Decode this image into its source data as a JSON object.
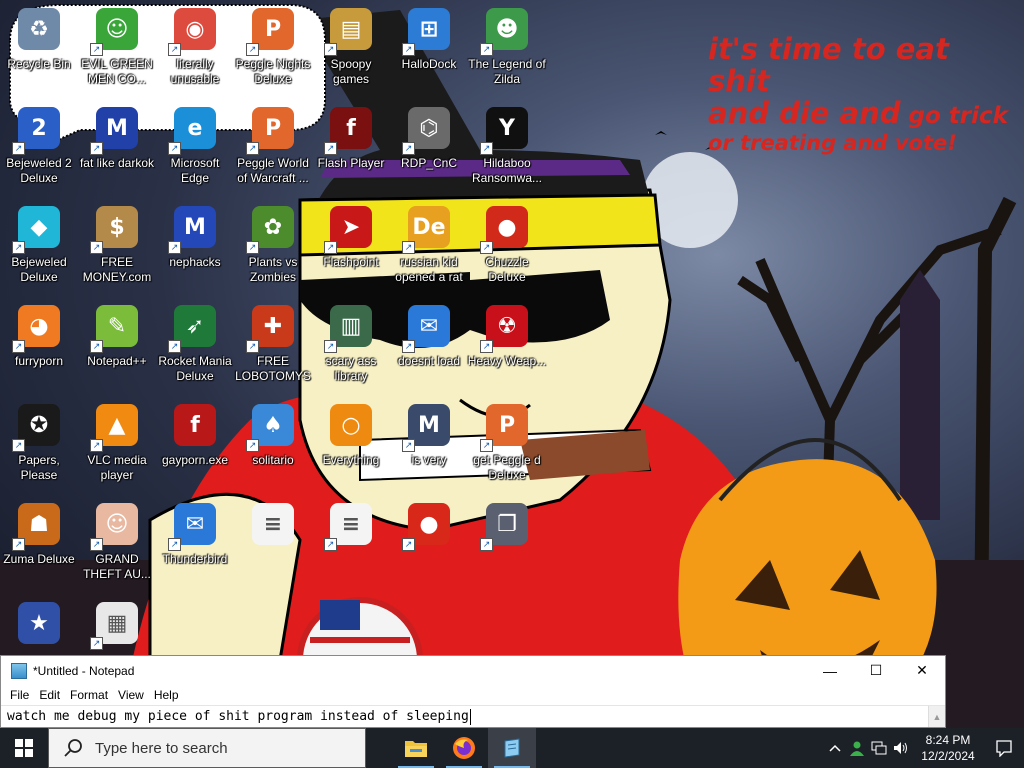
{
  "speech_bubble": {
    "line1": "it's time to eat shit",
    "line2a": "and die and",
    "line2b": " go trick",
    "line3": "or treating and vote!"
  },
  "desktop_icons": [
    {
      "label": "Recycle Bin",
      "icon": "recycle-bin-icon",
      "color": "#6f8aa8",
      "glyph": "♻",
      "shortcut": false
    },
    {
      "label": "EVIL GREEN MEN CO...",
      "icon": "messenger-icon",
      "color": "#3aa63a",
      "glyph": "☺",
      "shortcut": true
    },
    {
      "label": "literally unusable",
      "icon": "chrome-icon",
      "color": "#dd4b3e",
      "glyph": "◉",
      "shortcut": true
    },
    {
      "label": "Peggle Nights Deluxe",
      "icon": "peggle-icon",
      "color": "#e2672d",
      "glyph": "P",
      "shortcut": true
    },
    {
      "label": "Spoopy games",
      "icon": "folder-icon",
      "color": "#c79b3b",
      "glyph": "▤",
      "shortcut": true
    },
    {
      "label": "HalloDock",
      "icon": "windows-shield-icon",
      "color": "#2c7bd4",
      "glyph": "⊞",
      "shortcut": true
    },
    {
      "label": "The Legend of Zilda",
      "icon": "zelda-icon",
      "color": "#3c9a4a",
      "glyph": "☻",
      "shortcut": true
    },
    {
      "label": "Bejeweled 2 Deluxe",
      "icon": "bejeweled-2-icon",
      "color": "#2a5fc8",
      "glyph": "2",
      "shortcut": true
    },
    {
      "label": "fat like darkok",
      "icon": "mpl-icon",
      "color": "#2140a8",
      "glyph": "M",
      "shortcut": true
    },
    {
      "label": "Microsoft Edge",
      "icon": "edge-icon",
      "color": "#1b8fd8",
      "glyph": "e",
      "shortcut": true
    },
    {
      "label": "Peggle World of Warcraft ...",
      "icon": "peggle-wow-icon",
      "color": "#e2672d",
      "glyph": "P",
      "shortcut": true
    },
    {
      "label": "Flash Player",
      "icon": "flash-icon",
      "color": "#7a1010",
      "glyph": "f",
      "shortcut": true
    },
    {
      "label": "RDP_CnC",
      "icon": "rdp-icon",
      "color": "#6a6a6a",
      "glyph": "⌬",
      "shortcut": true
    },
    {
      "label": "Hildaboo Ransomwa...",
      "icon": "yashma-icon",
      "color": "#101010",
      "glyph": "Y",
      "shortcut": true
    },
    {
      "label": "Bejeweled Deluxe",
      "icon": "gem-icon",
      "color": "#1fb6d8",
      "glyph": "◆",
      "shortcut": true
    },
    {
      "label": "FREE MONEY.com",
      "icon": "money-bag-icon",
      "color": "#b38a4a",
      "glyph": "$",
      "shortcut": true
    },
    {
      "label": "nephacks",
      "icon": "mpi-icon",
      "color": "#2448b8",
      "glyph": "M",
      "shortcut": true
    },
    {
      "label": "Plants vs Zombies",
      "icon": "pvz-icon",
      "color": "#4c8c2c",
      "glyph": "✿",
      "shortcut": true
    },
    {
      "label": "Flashpoint",
      "icon": "flashpoint-icon",
      "color": "#c81818",
      "glyph": "➤",
      "shortcut": true
    },
    {
      "label": "russian kid opened a rat",
      "icon": "de-icon",
      "color": "#e8a020",
      "glyph": "De",
      "shortcut": true
    },
    {
      "label": "Chuzzle Deluxe",
      "icon": "chuzzle-icon",
      "color": "#d22a1a",
      "glyph": "●",
      "shortcut": true
    },
    {
      "label": "furryporn",
      "icon": "firefox-icon",
      "color": "#ef7a22",
      "glyph": "◕",
      "shortcut": true
    },
    {
      "label": "Notepad++",
      "icon": "notepad-plus-icon",
      "color": "#7bbd3a",
      "glyph": "✎",
      "shortcut": true
    },
    {
      "label": "Rocket Mania Deluxe",
      "icon": "rocket-mania-icon",
      "color": "#1f7a3a",
      "glyph": "➶",
      "shortcut": true
    },
    {
      "label": "FREE LOBOTOMYS",
      "icon": "lobotomy-icon",
      "color": "#c83a1a",
      "glyph": "✚",
      "shortcut": true
    },
    {
      "label": "scary ass library",
      "icon": "library-icon",
      "color": "#3a6a4a",
      "glyph": "▥",
      "shortcut": true
    },
    {
      "label": "doesnt load",
      "icon": "thunderbird-icon",
      "color": "#2a78d8",
      "glyph": "✉",
      "shortcut": true
    },
    {
      "label": "Heavy Weap...",
      "icon": "radiation-icon",
      "color": "#c8101a",
      "glyph": "☢",
      "shortcut": true
    },
    {
      "label": "Papers, Please",
      "icon": "papers-please-icon",
      "color": "#1a1a1a",
      "glyph": "✪",
      "shortcut": true
    },
    {
      "label": "VLC media player",
      "icon": "vlc-icon",
      "color": "#f08a10",
      "glyph": "▲",
      "shortcut": true
    },
    {
      "label": "gayporn.exe",
      "icon": "flash-exe-icon",
      "color": "#b81818",
      "glyph": "f",
      "shortcut": false
    },
    {
      "label": "solitario",
      "icon": "solitaire-icon",
      "color": "#3a88d8",
      "glyph": "♠",
      "shortcut": true
    },
    {
      "label": "Everything",
      "icon": "everything-search-icon",
      "color": "#ef8a10",
      "glyph": "○",
      "shortcut": false
    },
    {
      "label": "is very",
      "icon": "mpi-shield-icon",
      "color": "#3a4a6a",
      "glyph": "M",
      "shortcut": true
    },
    {
      "label": "get Peggle d Deluxe",
      "icon": "peggle-deluxe-icon",
      "color": "#e2672d",
      "glyph": "P",
      "shortcut": true
    },
    {
      "label": "Zuma Deluxe",
      "icon": "zuma-icon",
      "color": "#c86a1a",
      "glyph": "☗",
      "shortcut": true
    },
    {
      "label": "GRAND THEFT AU...",
      "icon": "anime-girl-icon",
      "color": "#e8b8a0",
      "glyph": "☺",
      "shortcut": true
    },
    {
      "label": "Thunderbird",
      "icon": "thunderbird-2-icon",
      "color": "#2a78d8",
      "glyph": "✉",
      "shortcut": true
    },
    {
      "label": "",
      "icon": "text-document-icon",
      "color": "#f4f4f4",
      "glyph": "≡",
      "shortcut": false
    },
    {
      "label": "",
      "icon": "text-document-2-icon",
      "color": "#f4f4f4",
      "glyph": "≡",
      "shortcut": true
    },
    {
      "label": "",
      "icon": "angry-birds-icon",
      "color": "#d8281a",
      "glyph": "●",
      "shortcut": true
    },
    {
      "label": "",
      "icon": "windows-stack-icon",
      "color": "#5a6070",
      "glyph": "❐",
      "shortcut": true
    },
    {
      "label": "",
      "icon": "vote-badge-icon",
      "color": "#3050a8",
      "glyph": "★",
      "shortcut": false
    },
    {
      "label": "",
      "icon": "pixel-cat-icon",
      "color": "#e8e8e8",
      "glyph": "▦",
      "shortcut": true
    }
  ],
  "notepad": {
    "title": "*Untitled - Notepad",
    "menu": [
      "File",
      "Edit",
      "Format",
      "View",
      "Help"
    ],
    "content": "watch me debug my piece of shit program instead of sleeping",
    "minimize": "—",
    "maximize": "☐",
    "close": "✕"
  },
  "taskbar": {
    "search_placeholder": "Type here to search",
    "apps": [
      "file-explorer-icon",
      "firefox-icon",
      "notepad-icon"
    ],
    "time": "8:24 PM",
    "date": "12/2/2024"
  }
}
